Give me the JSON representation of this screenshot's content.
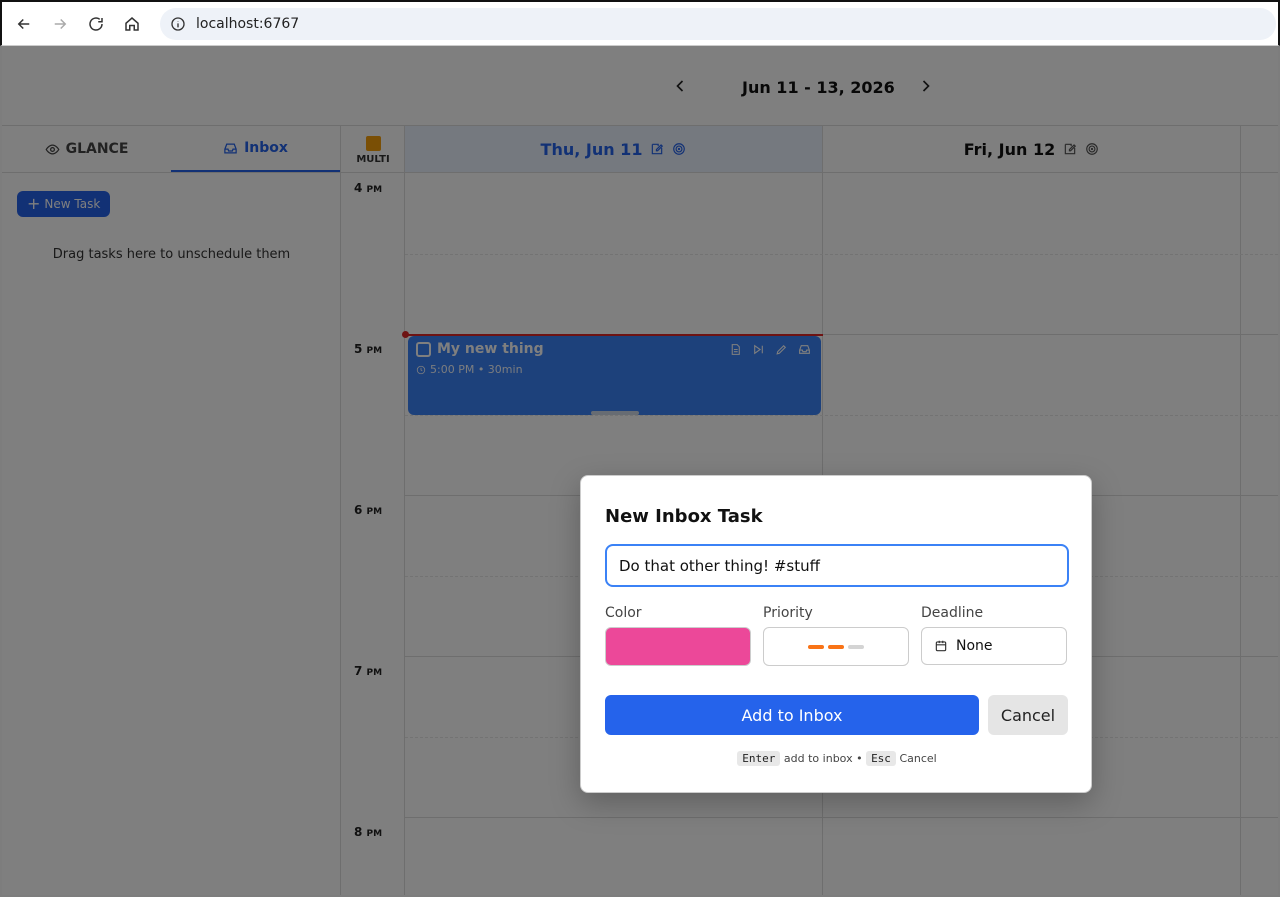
{
  "browser": {
    "url": "localhost:6767"
  },
  "header": {
    "date_range": "Jun 11 - 13, 2026"
  },
  "sidebar": {
    "tabs": [
      {
        "label": "GLANCE",
        "icon": "eye-icon"
      },
      {
        "label": "Inbox",
        "icon": "inbox-icon"
      }
    ],
    "new_task_label": "New Task",
    "drag_hint": "Drag tasks here to unschedule them"
  },
  "calendar": {
    "multi_label": "MULTI",
    "days": [
      {
        "label": "Thu, Jun 11",
        "today": true
      },
      {
        "label": "Fri, Jun 12",
        "today": false
      }
    ],
    "hours": [
      {
        "num": "4",
        "suffix": "PM"
      },
      {
        "num": "5",
        "suffix": "PM"
      },
      {
        "num": "6",
        "suffix": "PM"
      },
      {
        "num": "7",
        "suffix": "PM"
      },
      {
        "num": "8",
        "suffix": "PM"
      }
    ],
    "event": {
      "title": "My new thing",
      "meta": "5:00 PM • 30min"
    }
  },
  "modal": {
    "title": "New Inbox Task",
    "task_value": "Do that other thing! #stuff",
    "color_label": "Color",
    "color_value": "#ec4899",
    "priority_label": "Priority",
    "deadline_label": "Deadline",
    "deadline_value": "None",
    "add_label": "Add to Inbox",
    "cancel_label": "Cancel",
    "hint": {
      "key1": "Enter",
      "text1": "add to inbox •",
      "key2": "Esc",
      "text2": "Cancel"
    }
  },
  "colors": {
    "accent": "#2563eb",
    "event": "#3b82f6",
    "priority_on": "#f97316",
    "priority_off": "#d4d4d4"
  }
}
